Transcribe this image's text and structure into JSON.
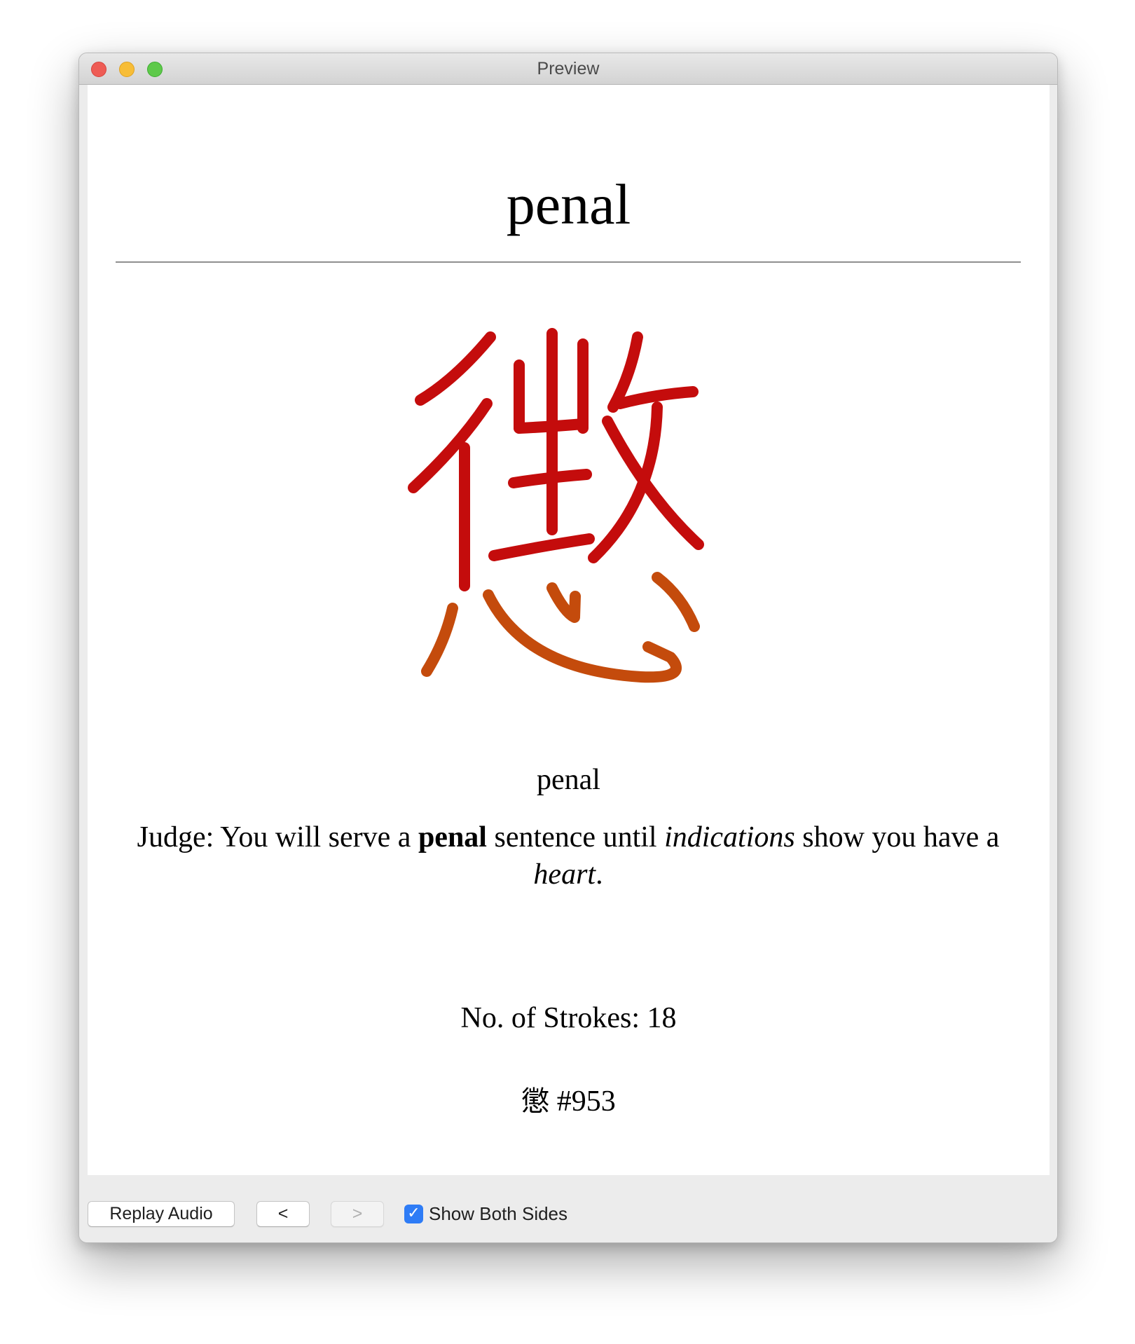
{
  "window": {
    "title": "Preview"
  },
  "card": {
    "front_word": "penal",
    "kanji_char": "懲",
    "stroke_colors": {
      "upper_component": "#c40c0c",
      "heart_component": "#c44b0c"
    },
    "meaning": "penal",
    "sentence": {
      "part1": "Judge: You will serve a ",
      "bold": "penal",
      "part2": " sentence until ",
      "italic1": "indications",
      "part3": " show you have a ",
      "italic2": "heart",
      "part4": "."
    },
    "strokes_label": "No. of Strokes: 18",
    "kanji_number": "#953"
  },
  "toolbar": {
    "replay_label": "Replay Audio",
    "prev_label": "<",
    "next_label": ">",
    "show_both_label": "Show Both Sides",
    "show_both_checked": true
  },
  "icons": {
    "window_close": "close-icon",
    "window_minimize": "minimize-icon",
    "window_zoom": "zoom-icon",
    "checkbox": "checkmark-icon"
  }
}
